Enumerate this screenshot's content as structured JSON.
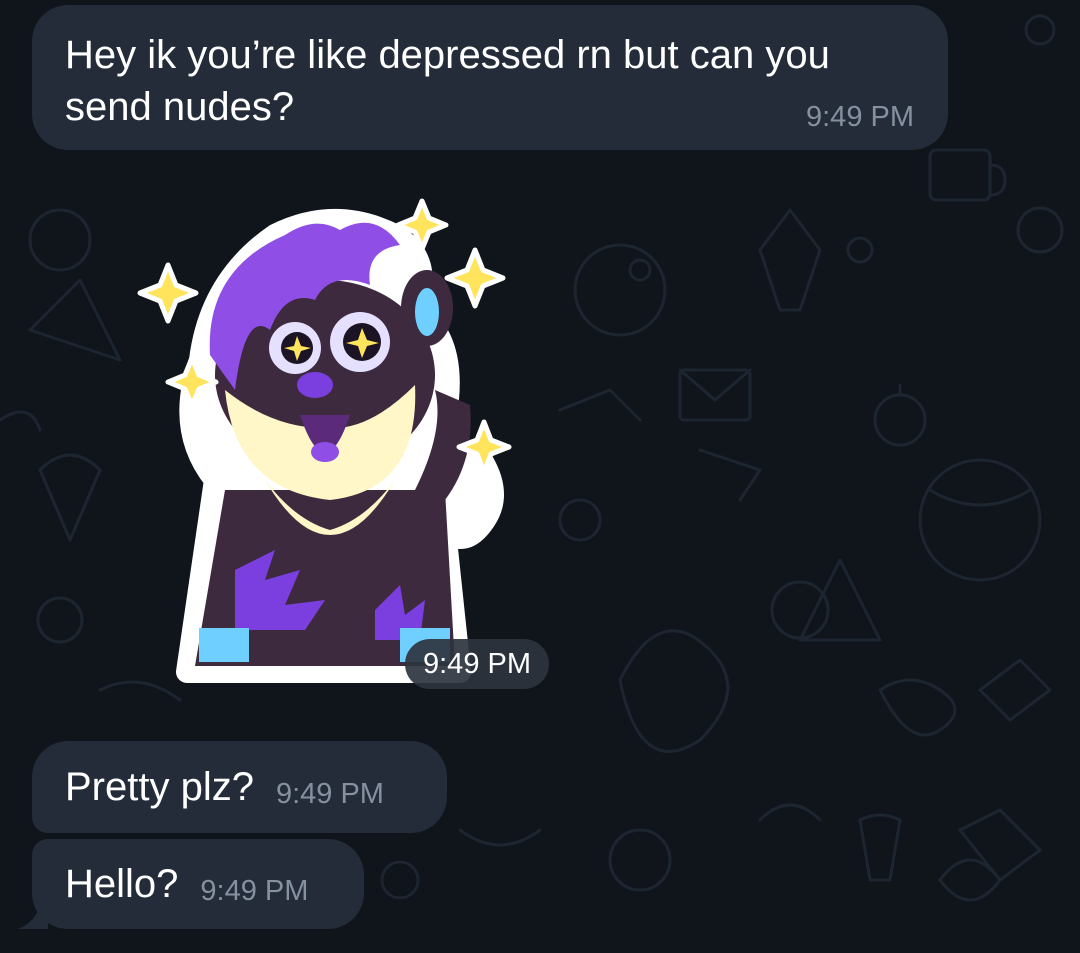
{
  "messages": [
    {
      "type": "text",
      "text": "Hey ik you’re like depressed rn but can you send nudes?",
      "time": "9:49 PM"
    },
    {
      "type": "sticker",
      "icon": "purple-furry-sticker",
      "time": "9:49 PM"
    },
    {
      "type": "text",
      "text": "Pretty plz?",
      "time": "9:49 PM"
    },
    {
      "type": "text",
      "text": "Hello?",
      "time": "9:49 PM"
    }
  ],
  "colors": {
    "background": "#10151c",
    "bubble": "#232c38",
    "time_text": "#8591a0",
    "sticker_fur_dark": "#3e2a3e",
    "sticker_fur_purple": "#7b3fe0",
    "sticker_cream": "#fff7c8",
    "sparkle": "#ffe45c"
  }
}
